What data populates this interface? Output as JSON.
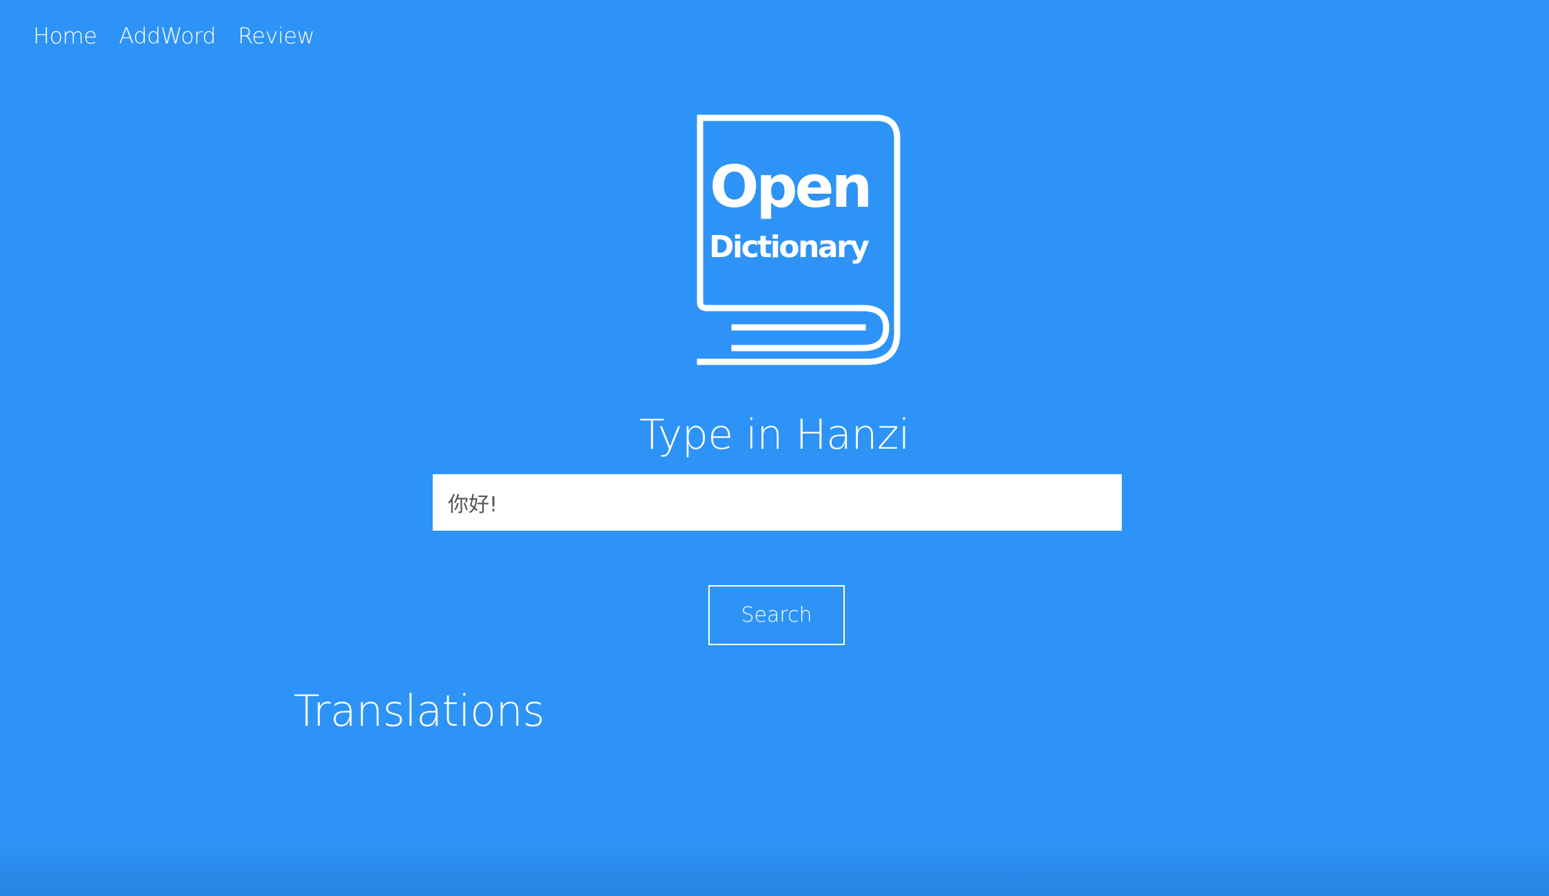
{
  "nav": {
    "items": [
      {
        "label": "Home"
      },
      {
        "label": "AddWord"
      },
      {
        "label": "Review"
      }
    ]
  },
  "logo": {
    "line1": "Open",
    "line2": "Dictionary",
    "icon": "book-icon"
  },
  "search": {
    "heading": "Type in Hanzi",
    "value": "你好!",
    "button_label": "Search"
  },
  "results": {
    "heading": "Translations"
  },
  "colors": {
    "background": "#2e93f6",
    "foreground": "#ffffff"
  }
}
